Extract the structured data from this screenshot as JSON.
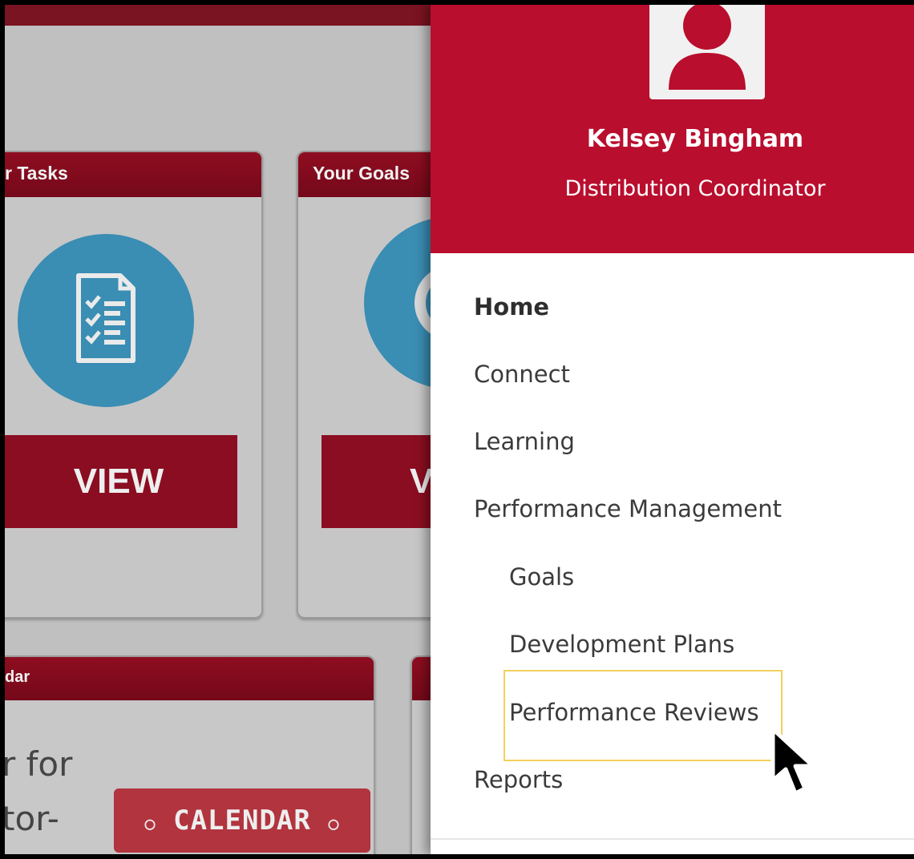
{
  "background": {
    "tasks_card": {
      "title": "r Tasks",
      "button_label": "VIEW"
    },
    "goals_card": {
      "title": "Your Goals",
      "button_label": "V"
    },
    "calendar_card": {
      "title": "dar",
      "text_line1": "r for",
      "text_line2": "tor-",
      "badge_label": "CALENDAR"
    }
  },
  "sidebar": {
    "user": {
      "name": "Kelsey Bingham",
      "role": "Distribution Coordinator"
    },
    "nav": {
      "home": "Home",
      "connect": "Connect",
      "learning": "Learning",
      "performance_management": "Performance Management",
      "goals": "Goals",
      "development_plans": "Development Plans",
      "performance_reviews": "Performance Reviews",
      "reports": "Reports"
    }
  },
  "colors": {
    "brand_red": "#b90e2e",
    "card_header": "#8f0d20",
    "icon_blue": "#3a8db3",
    "highlight": "#f2d15c"
  },
  "icons": [
    "task-list-icon",
    "target-icon",
    "avatar-icon",
    "cursor-icon"
  ]
}
